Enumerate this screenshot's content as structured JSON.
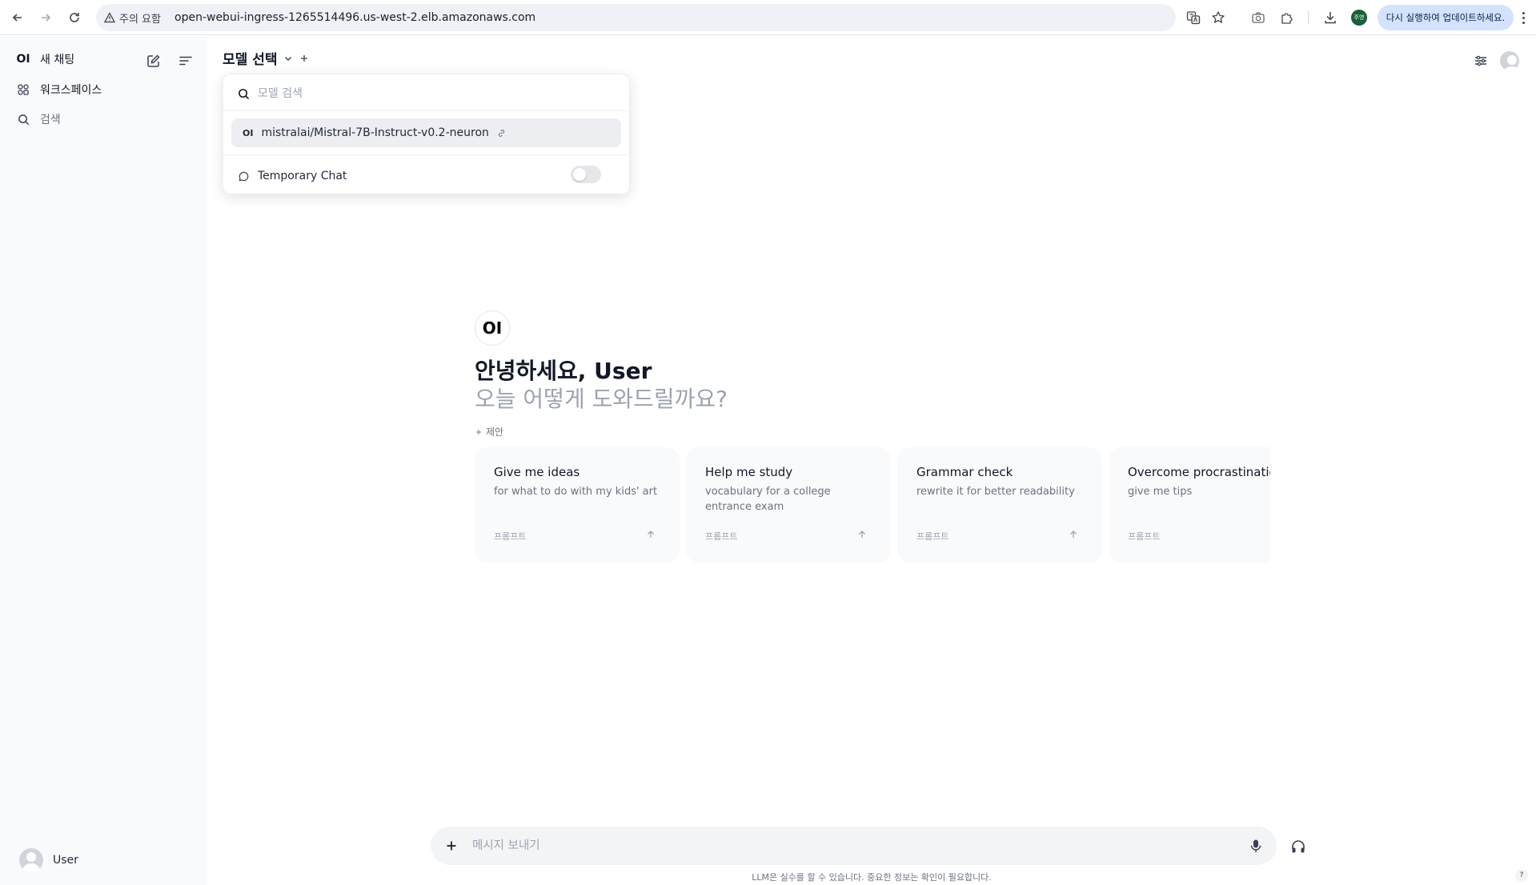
{
  "browser": {
    "security_label": "주의 요함",
    "url": "open-webui-ingress-1265514496.us-west-2.elb.amazonaws.com",
    "profile_initials": "주영",
    "update_button": "다시 실행하여 업데이트하세요."
  },
  "sidebar": {
    "logo": "OI",
    "new_chat": "새 채팅",
    "workspace": "워크스페이스",
    "search": "검색",
    "user_name": "User"
  },
  "header": {
    "model_select": "모델 선택"
  },
  "model_dropdown": {
    "search_placeholder": "모델 검색",
    "model_logo": "OI",
    "model_name": "mistralai/Mistral-7B-Instruct-v0.2-neuron",
    "temporary_chat": "Temporary Chat",
    "temporary_chat_enabled": false
  },
  "welcome": {
    "logo": "OI",
    "greeting": "안녕하세요, User",
    "subtitle": "오늘 어떻게 도와드릴까요?",
    "suggestions_label": "제안"
  },
  "suggestions": [
    {
      "title": "Give me ideas",
      "desc": "for what to do with my kids' art",
      "tag": "프롬프트"
    },
    {
      "title": "Help me study",
      "desc": "vocabulary for a college entrance exam",
      "tag": "프롬프트"
    },
    {
      "title": "Grammar check",
      "desc": "rewrite it for better readability",
      "tag": "프롬프트"
    },
    {
      "title": "Overcome procrastination",
      "desc": "give me tips",
      "tag": "프롬프트"
    }
  ],
  "composer": {
    "placeholder": "메시지 보내기",
    "disclaimer": "LLM은 실수를 할 수 있습니다. 중요한 정보는 확인이 필요합니다.",
    "help": "?"
  }
}
